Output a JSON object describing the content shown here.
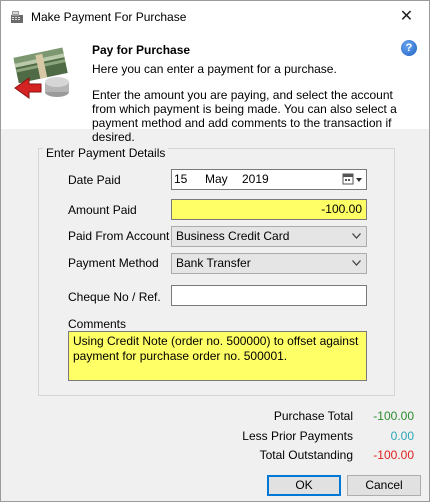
{
  "window": {
    "title": "Make Payment For Purchase"
  },
  "header": {
    "title": "Pay for Purchase",
    "subtitle": "Here you can enter a payment for a purchase.",
    "description": "Enter the amount you are paying, and select the account from which payment is being made. You can also select a payment method and add comments to the transaction if desired."
  },
  "group": {
    "legend": "Enter Payment Details"
  },
  "form": {
    "date_label": "Date Paid",
    "date_day": "15",
    "date_month": "May",
    "date_year": "2019",
    "amount_label": "Amount Paid",
    "amount_value": "-100.00",
    "account_label": "Paid From Account",
    "account_value": "Business Credit Card",
    "method_label": "Payment Method",
    "method_value": "Bank Transfer",
    "cheque_label": "Cheque No / Ref.",
    "cheque_value": "",
    "comments_label": "Comments",
    "comments_value": "Using Credit Note (order no. 500000) to offset against payment for purchase order no. 500001."
  },
  "summary": {
    "purchase_total_label": "Purchase Total",
    "purchase_total_value": "-100.00",
    "prior_payments_label": "Less Prior Payments",
    "prior_payments_value": "0.00",
    "outstanding_label": "Total Outstanding",
    "outstanding_value": "-100.00"
  },
  "buttons": {
    "ok": "OK",
    "cancel": "Cancel"
  },
  "colors": {
    "highlight_field": "#ffff66",
    "positive_green": "#2e8b2e",
    "zero_teal": "#2ba6b7",
    "negative_red": "#e02020"
  }
}
